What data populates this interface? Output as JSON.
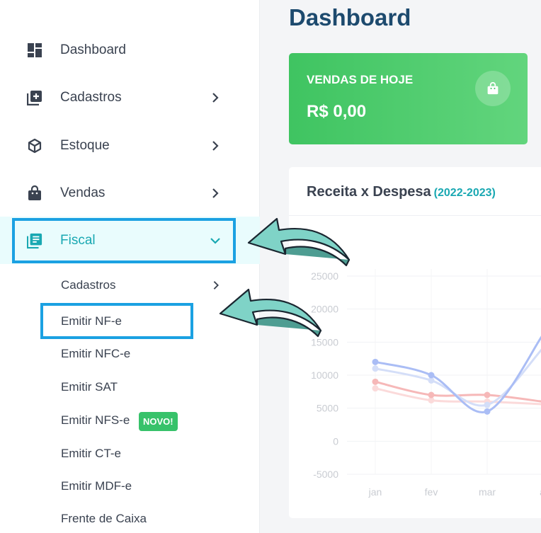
{
  "sidebar": {
    "items": [
      {
        "label": "Dashboard",
        "icon": "dashboard-icon"
      },
      {
        "label": "Cadastros",
        "icon": "add-box-icon"
      },
      {
        "label": "Estoque",
        "icon": "package-icon"
      },
      {
        "label": "Vendas",
        "icon": "shopping-bag-icon"
      },
      {
        "label": "Fiscal",
        "icon": "document-icon"
      }
    ],
    "fiscal_submenu": [
      {
        "label": "Cadastros"
      },
      {
        "label": "Emitir NF-e"
      },
      {
        "label": "Emitir NFC-e"
      },
      {
        "label": "Emitir SAT"
      },
      {
        "label": "Emitir NFS-e",
        "badge": "NOVO!"
      },
      {
        "label": "Emitir CT-e"
      },
      {
        "label": "Emitir MDF-e"
      },
      {
        "label": "Frente de Caixa"
      }
    ]
  },
  "main": {
    "title": "Dashboard",
    "sales_card": {
      "title": "VENDAS DE HOJE",
      "value": "R$ 0,00",
      "icon": "shopping-bag-icon"
    },
    "chart_card": {
      "title": "Receita x Despesa",
      "subtitle": "(2022-2023)"
    }
  },
  "colors": {
    "accent": "#19a8b2",
    "highlight_border": "#1ba1e2",
    "green": "#3fc461",
    "badge_green": "#37c26a",
    "title_blue": "#1d4a6e",
    "arrow_fill": "#7fd3c7"
  },
  "chart_data": {
    "type": "line",
    "categories": [
      "jan",
      "fev",
      "mar",
      "a"
    ],
    "yticks": [
      25000,
      20000,
      15000,
      10000,
      5000,
      0,
      -5000
    ],
    "ylim": [
      -5000,
      27000
    ],
    "grid": true,
    "series": [
      {
        "color": "#aabdf5",
        "values": [
          12000,
          10000,
          4500,
          16000
        ]
      },
      {
        "color": "#d4def8",
        "values": [
          11000,
          9200,
          5500,
          14000
        ]
      },
      {
        "color": "#f6b8b8",
        "values": [
          9000,
          7000,
          7000,
          6000
        ]
      },
      {
        "color": "#fbdada",
        "values": [
          8000,
          6200,
          6000,
          5600
        ]
      }
    ]
  }
}
